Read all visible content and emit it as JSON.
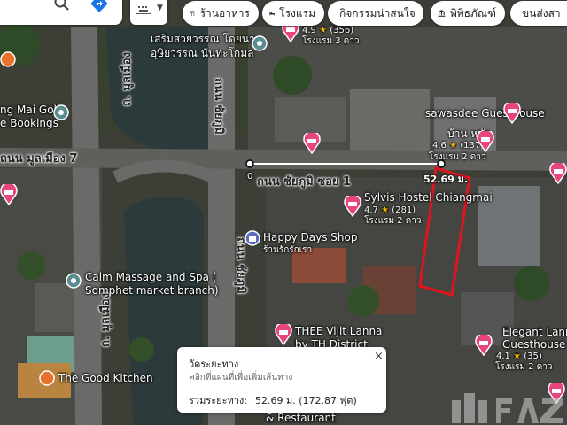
{
  "toolbar": {
    "search_icon": "search-icon",
    "directions_icon": "directions-icon",
    "layers_icon": "keyboard-icon",
    "chips": [
      {
        "label": "ร้านอาหาร",
        "icon": "fork-knife-icon"
      },
      {
        "label": "โรงแรม",
        "icon": "bed-icon"
      },
      {
        "label": "กิจกรรมน่าสนใจ",
        "icon": "camera-icon"
      },
      {
        "label": "พิพิธภัณฑ์",
        "icon": "museum-icon"
      },
      {
        "label": "ขนส่งสา",
        "icon": "transit-icon"
      }
    ]
  },
  "places": {
    "temple_line1": "เสริมสวยวรรณ โดยนาง",
    "temple_line2": "อุษิยวรรณ นันทะโกมล",
    "golf1": "ng Mai Golf",
    "golf2": "e Bookings",
    "hotel_top_rating": "4.9",
    "hotel_top_reviews": "(356)",
    "hotel_top_type": "โรงแรม 3 ดาว",
    "sawasdee": "sawasdee Guesthouse",
    "bankhai_name": "บ้าน หทัย",
    "bankhai_rating": "4.6",
    "bankhai_reviews": "(137)",
    "bankhai_type": "โรงแรม 2 ดาว",
    "sylvis_name1": "Sylvis Hostel Chiangmai",
    "sylvis_rating": "4.7",
    "sylvis_reviews": "(281)",
    "sylvis_type": "โรงแรม 2 ดาว",
    "happy_days": "Happy Days Shop",
    "happy_days_sub": "ร้านรักรักเรา",
    "calm1": "Calm Massage and Spa (",
    "calm2": "Somphet market branch)",
    "thee1": "THEE Vijit Lanna",
    "thee2": "by TH District",
    "elegant1": "Elegant Lanna",
    "elegant2": "Guesthouse",
    "elegant_rating": "4.1",
    "elegant_reviews": "(35)",
    "elegant_type": "โรงแรม 2 ดาว",
    "good_kitchen": "The Good Kitchen",
    "restaurant": "& Restaurant"
  },
  "roads": {
    "moonmuang_7": "ถนน มูลเมือง 7",
    "moonmuang_v1": "ถ. มูลเมือง",
    "moonmuang_v2": "ถ. มูลเมือง",
    "chaiyaphum_soi1": "ถนน ชัยภูมิ ซอย 1",
    "chaiyaphum_v1": "ถนน ชัยภูมิ",
    "chaiyaphum_v2": "ถนน ชัยภูมิ"
  },
  "measurement": {
    "start_label": "0",
    "distance_label": "52.69 ม."
  },
  "card": {
    "title": "วัดระยะทาง",
    "subtitle": "คลิกที่แผนที่เพื่อเพิ่มเส้นทาง",
    "total_label": "รวมระยะทาง:",
    "total_value": "52.69 ม. (172.87 ฟุต)",
    "close": "×"
  },
  "colors": {
    "hotel_pin": "#e8457f",
    "place_pin": "#5a8d8f",
    "measure_line": "#ffffff",
    "highlight": "#e0141e",
    "shop_pin": "#5c6bc0"
  }
}
